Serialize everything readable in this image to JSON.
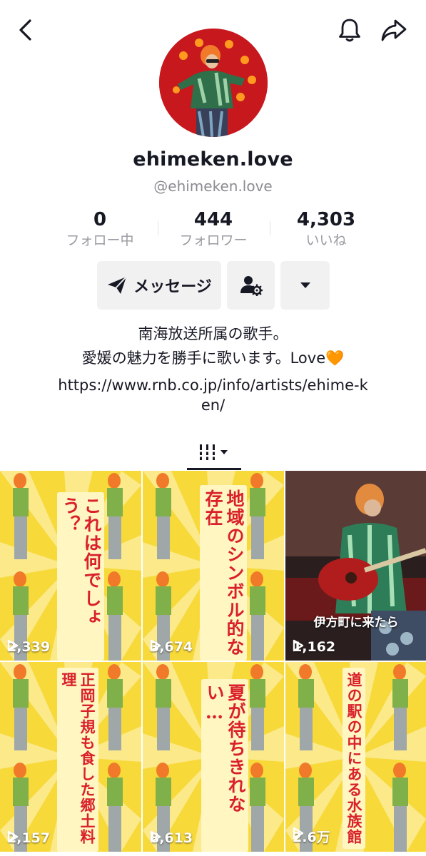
{
  "profile": {
    "display_name": "ehimeken.love",
    "handle": "@ehimeken.love"
  },
  "stats": [
    {
      "value": "0",
      "label": "フォロー中"
    },
    {
      "value": "444",
      "label": "フォロワー"
    },
    {
      "value": "4,303",
      "label": "いいね"
    }
  ],
  "actions": {
    "message_label": "メッセージ"
  },
  "bio": {
    "line1": "南海放送所属の歌手。",
    "line2": "愛媛の魅力を勝手に歌います。Love🧡",
    "link": "https://www.rnb.co.jp/info/artists/ehime-ken/"
  },
  "icons": {
    "back": "chevron-left-icon",
    "bell": "bell-icon",
    "share": "share-arrow-icon",
    "message": "send-icon",
    "add_user": "user-settings-icon",
    "more": "caret-down-icon",
    "grid_tab": "video-grid-icon",
    "play": "play-icon"
  },
  "colors": {
    "text": "#161823",
    "muted": "#8a8b91",
    "button_bg": "#f1f1f2",
    "tile_text": "#d9202b",
    "tile_bg": "#f8d93a"
  },
  "videos": [
    {
      "title": "これは何でしょう？",
      "views": "2,339"
    },
    {
      "title": "地域のシンボル的な存在",
      "views": "3,674"
    },
    {
      "title": "伊方町に来たら",
      "views": "1,162"
    },
    {
      "title": "正岡子規も食した郷土料理",
      "views": "2,157"
    },
    {
      "title": "夏が待ちきれない…",
      "views": "8,613"
    },
    {
      "title": "道の駅の中にある水族館",
      "views": "2.6万"
    }
  ]
}
